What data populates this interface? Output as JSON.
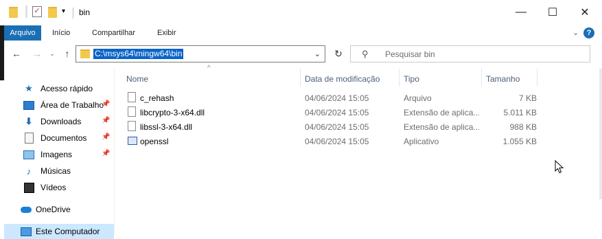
{
  "window": {
    "title": "bin",
    "controls": {
      "minimize": "—",
      "maximize": "☐",
      "close": "✕"
    }
  },
  "ribbon": {
    "tabs": [
      "Arquivo",
      "Início",
      "Compartilhar",
      "Exibir"
    ],
    "expand_icon": "chevron-down-icon",
    "help_label": "?"
  },
  "address": {
    "path": "C:\\msys64\\mingw64\\bin",
    "search_placeholder": "Pesquisar bin"
  },
  "nav": {
    "items": [
      {
        "label": "Acesso rápido",
        "icon": "star-icon",
        "pinned": false
      },
      {
        "label": "Área de Trabalho",
        "icon": "desktop-icon",
        "pinned": true
      },
      {
        "label": "Downloads",
        "icon": "download-icon",
        "pinned": true
      },
      {
        "label": "Documentos",
        "icon": "documents-icon",
        "pinned": true
      },
      {
        "label": "Imagens",
        "icon": "pictures-icon",
        "pinned": true
      },
      {
        "label": "Músicas",
        "icon": "music-icon",
        "pinned": false
      },
      {
        "label": "Vídeos",
        "icon": "video-icon",
        "pinned": false
      },
      {
        "label": "OneDrive",
        "icon": "cloud-icon",
        "pinned": false
      },
      {
        "label": "Este Computador",
        "icon": "computer-icon",
        "pinned": false
      }
    ]
  },
  "columns": {
    "name": "Nome",
    "date": "Data de modificação",
    "type": "Tipo",
    "size": "Tamanho"
  },
  "files": [
    {
      "name": "c_rehash",
      "date": "04/06/2024 15:05",
      "type": "Arquivo",
      "size": "7 KB"
    },
    {
      "name": "libcrypto-3-x64.dll",
      "date": "04/06/2024 15:05",
      "type": "Extensão de aplica...",
      "size": "5.011 KB"
    },
    {
      "name": "libssl-3-x64.dll",
      "date": "04/06/2024 15:05",
      "type": "Extensão de aplica...",
      "size": "988 KB"
    },
    {
      "name": "openssl",
      "date": "04/06/2024 15:05",
      "type": "Aplicativo",
      "size": "1.055 KB"
    }
  ],
  "colors": {
    "accent": "#1a6fb5",
    "selection": "#0a64c8",
    "nav_selected": "#cce8ff"
  }
}
